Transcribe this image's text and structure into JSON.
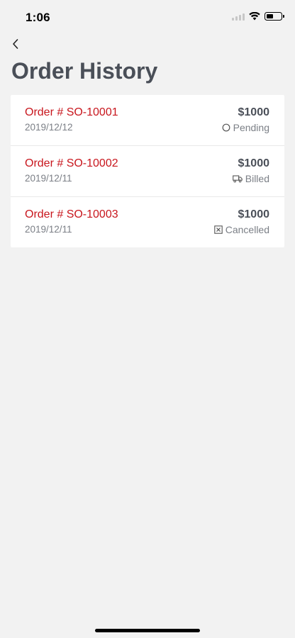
{
  "status_bar": {
    "time": "1:06"
  },
  "header": {
    "title": "Order History"
  },
  "orders": [
    {
      "number": "Order # SO-10001",
      "date": "2019/12/12",
      "amount": "$1000",
      "status": "Pending",
      "status_icon": "circle-icon"
    },
    {
      "number": "Order # SO-10002",
      "date": "2019/12/11",
      "amount": "$1000",
      "status": "Billed",
      "status_icon": "truck-icon"
    },
    {
      "number": "Order # SO-10003",
      "date": "2019/12/11",
      "amount": "$1000",
      "status": "Cancelled",
      "status_icon": "cancel-box-icon"
    }
  ],
  "colors": {
    "accent": "#c8161d",
    "title": "#4a4f58",
    "muted": "#7b7f86",
    "background": "#f2f2f2"
  }
}
